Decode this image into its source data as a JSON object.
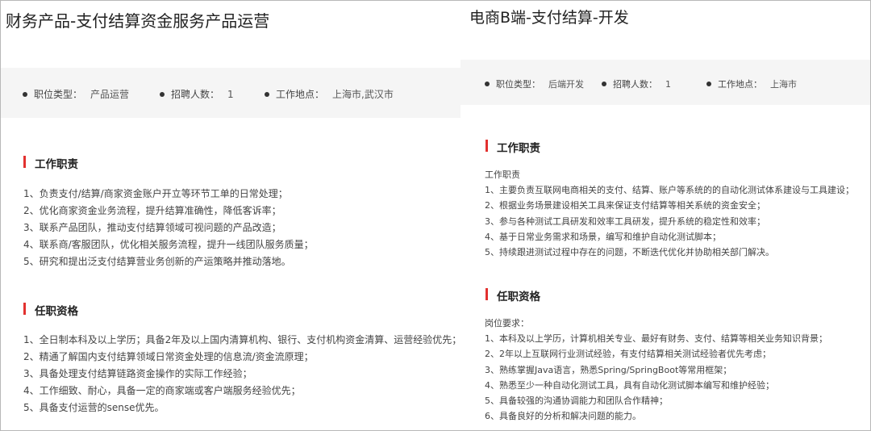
{
  "left": {
    "title": "财务产品-支付结算资金服务产品运营",
    "meta": [
      {
        "label": "职位类型：",
        "value": "产品运营"
      },
      {
        "label": "招聘人数：",
        "value": "1"
      },
      {
        "label": "工作地点：",
        "value": "上海市,武汉市"
      }
    ],
    "duties_title": "工作职责",
    "duties": [
      "1、负责支付/结算/商家资金账户开立等环节工单的日常处理；",
      "2、优化商家资金业务流程，提升结算准确性，降低客诉率；",
      "3、联系产品团队，推动支付结算领域可视问题的产品改造；",
      "4、联系商/客服团队，优化相关服务流程，提升一线团队服务质量；",
      "5、研究和提出泛支付结算营业务创新的产运策略并推动落地。"
    ],
    "req_title": "任职资格",
    "requirements": [
      "1、全日制本科及以上学历；具备2年及以上国内清算机构、银行、支付机构资金清算、运营经验优先；",
      "2、精通了解国内支付结算领域日常资金处理的信息流/资金流原理；",
      "3、具备处理支付结算链路资金操作的实际工作经验；",
      "4、工作细致、耐心，具备一定的商家端或客户端服务经验优先；",
      "5、具备支付运营的sense优先。"
    ]
  },
  "right": {
    "title": "电商B端-支付结算-开发",
    "meta": [
      {
        "label": "职位类型：",
        "value": "后端开发"
      },
      {
        "label": "招聘人数：",
        "value": "1"
      },
      {
        "label": "工作地点：",
        "value": "上海市"
      }
    ],
    "duties_title": "工作职责",
    "duties": [
      "工作职责",
      "1、主要负责互联网电商相关的支付、结算、账户等系统的的自动化测试体系建设与工具建设；",
      "2、根据业务场景建设相关工具来保证支付结算等相关系统的资金安全；",
      "3、参与各种测试工具研发和效率工具研发，提升系统的稳定性和效率；",
      "4、基于日常业务需求和场景，编写和维护自动化测试脚本；",
      "5、持续跟进测试过程中存在的问题，不断迭代优化并协助相关部门解决。"
    ],
    "req_title": "任职资格",
    "requirements": [
      "岗位要求：",
      "1、本科及以上学历，计算机相关专业、最好有财务、支付、结算等相关业务知识背景；",
      "2、2年以上互联网行业测试经验，有支付结算相关测试经验者优先考虑；",
      "3、熟练掌握Java语言，熟悉Spring/SpringBoot等常用框架；",
      "4、熟悉至少一种自动化测试工具，具有自动化测试脚本编写和维护经验；",
      "5、具备较强的沟通协调能力和团队合作精神；",
      "6、具备良好的分析和解决问题的能力。"
    ]
  },
  "colors": {
    "accent": "#e2312f",
    "band": "#f5f5f5",
    "text": "#444444"
  }
}
